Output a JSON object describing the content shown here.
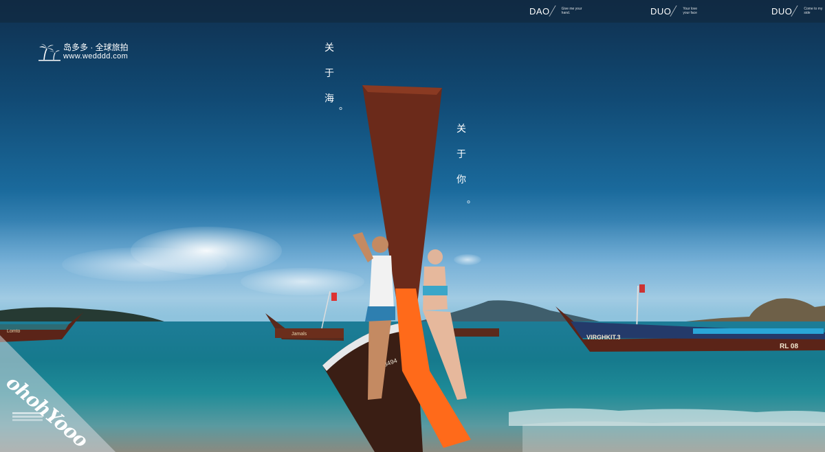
{
  "nav": {
    "items": [
      {
        "main": "DAO",
        "sub": "Give me your hand."
      },
      {
        "main": "DUO",
        "sub": "Your love your face"
      },
      {
        "main": "DUO",
        "sub": "Come to my side"
      }
    ]
  },
  "logo": {
    "name": "岛多多 · 全球旅拍",
    "url": "www.wedddd.com"
  },
  "poem": {
    "line1": [
      "关",
      "于",
      "海"
    ],
    "line2": [
      "关",
      "于",
      "你"
    ],
    "period": "。"
  },
  "boats": {
    "left_name": "Lomto",
    "mid_name": "Jamals",
    "right_name": "VIRGHKIT.3",
    "right_reg": "RL 08",
    "front_reg": "61 03494"
  },
  "corner": {
    "script": "ohohYooo"
  },
  "colors": {
    "sky_top": "#0f2f4e",
    "sea": "#1d7c97",
    "sash": "#ff6a1a",
    "boat_wood": "#6b2a1a"
  }
}
